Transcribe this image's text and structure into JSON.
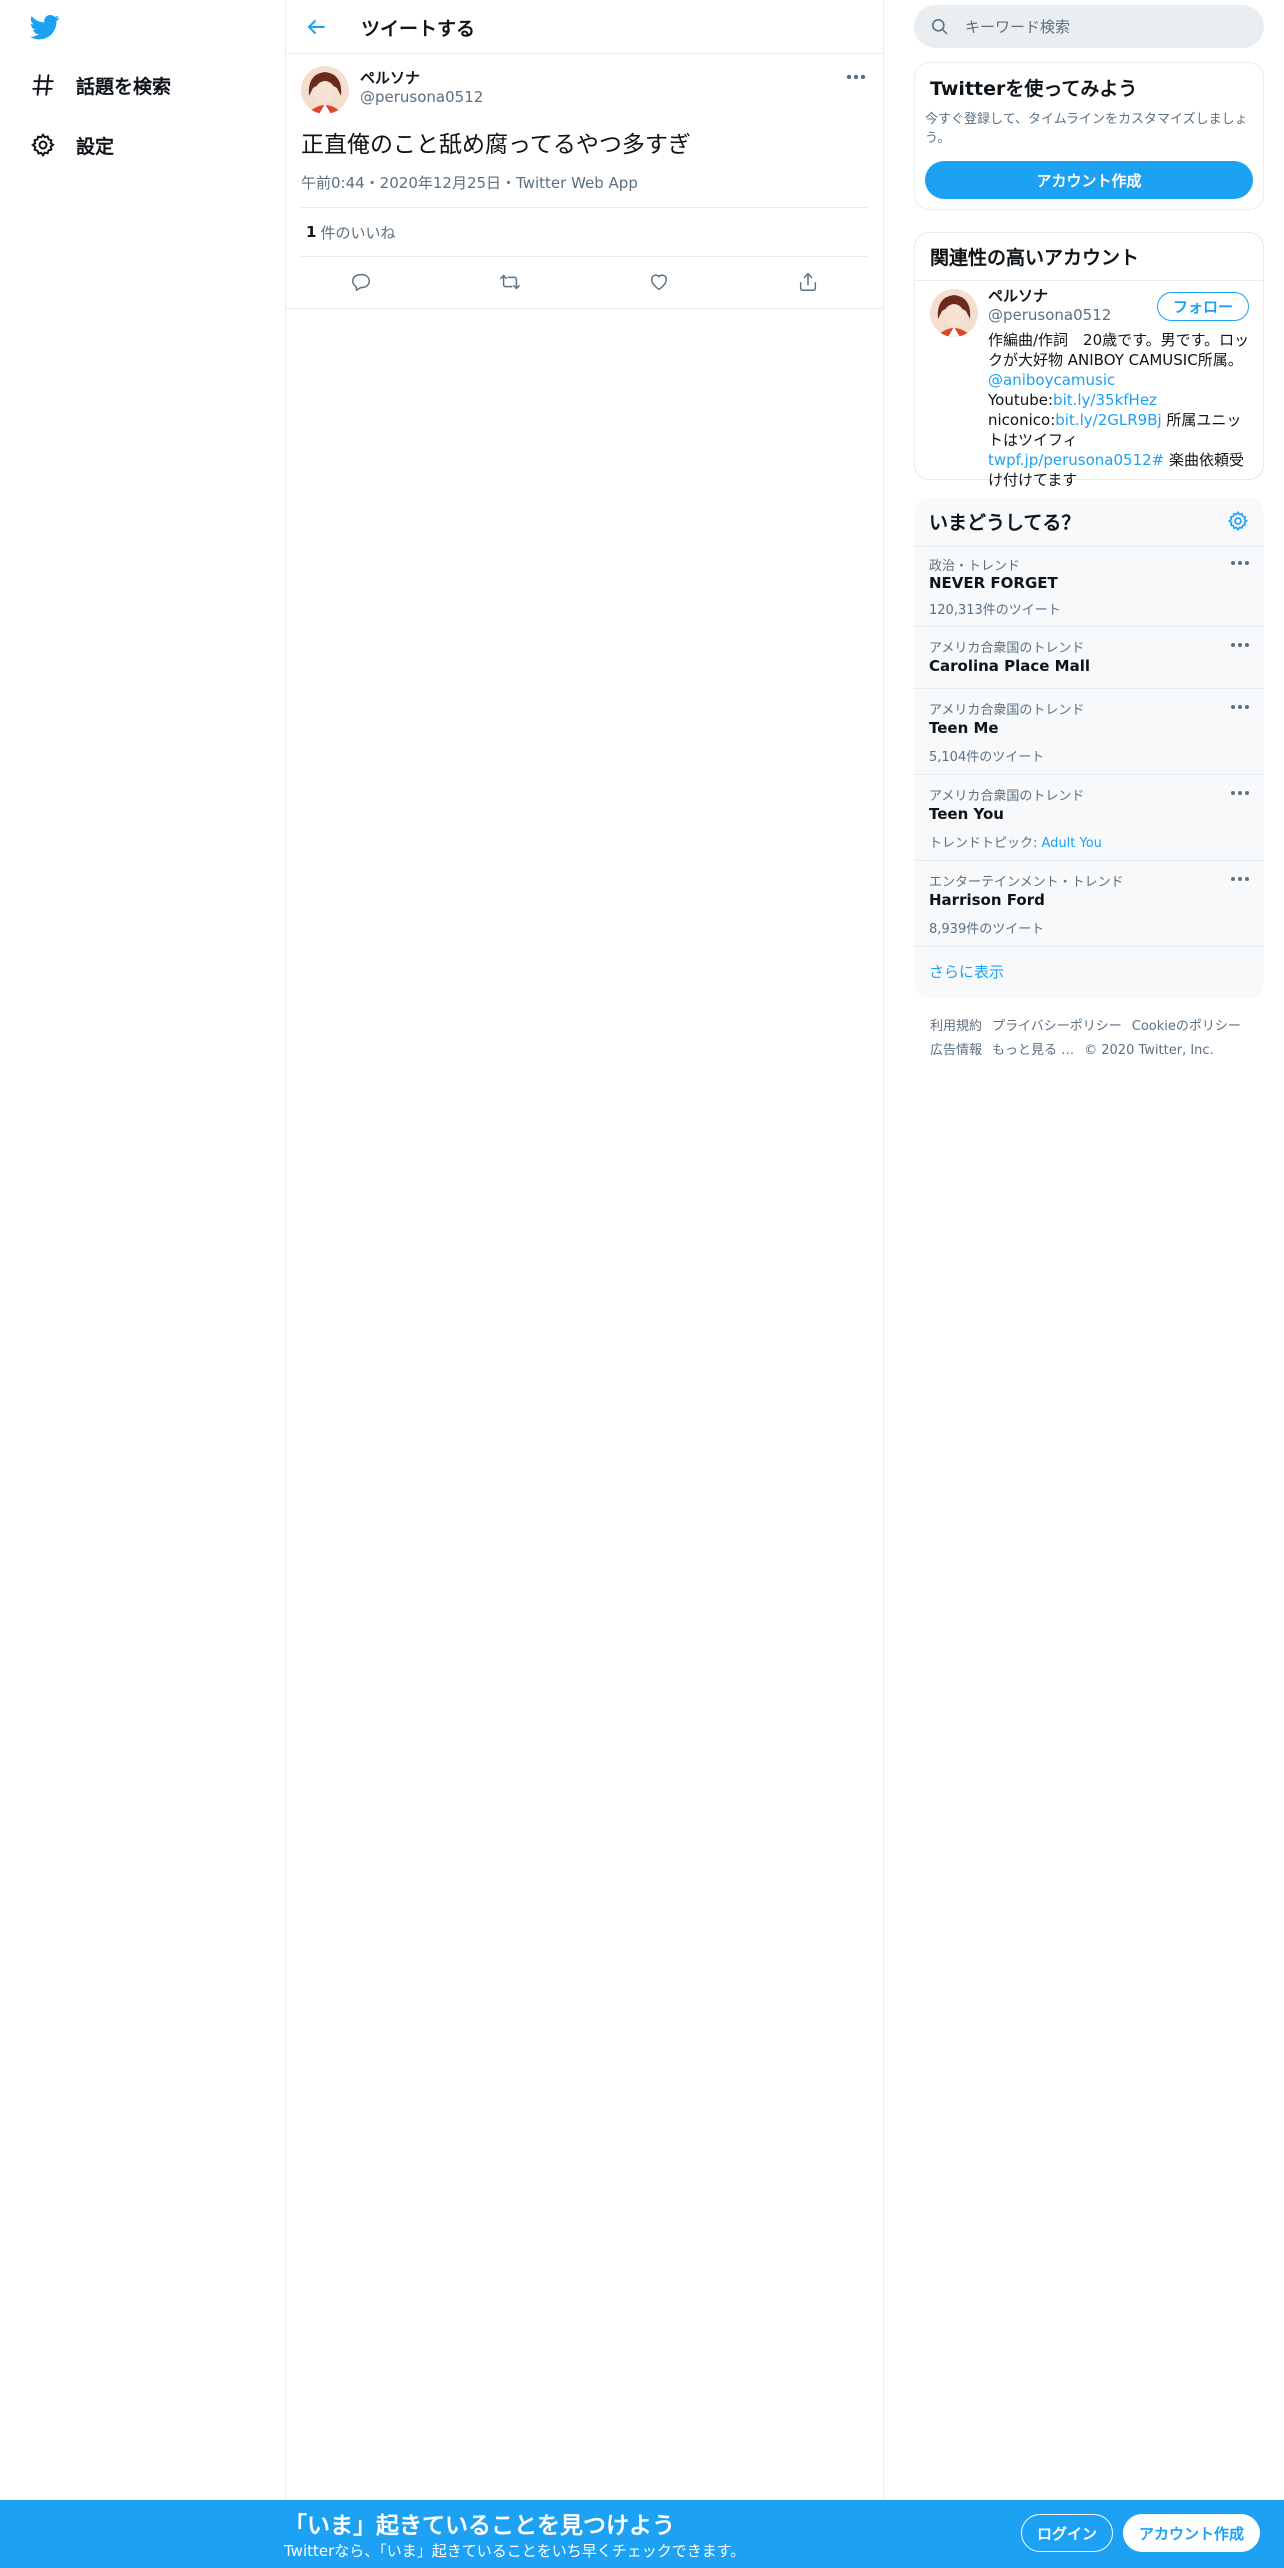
{
  "colors": {
    "accent": "#1da1f2",
    "text": "#0f1419",
    "muted": "#5b7083",
    "border": "#e6ecf0"
  },
  "nav": {
    "logo_icon": "twitter-bird-icon",
    "items": [
      {
        "label": "話題を検索",
        "icon": "hashtag-icon"
      },
      {
        "label": "設定",
        "icon": "gear-icon"
      }
    ]
  },
  "main": {
    "header_title": "ツイートする",
    "tweet": {
      "author_name": "ペルソナ",
      "author_handle": "@perusona0512",
      "text": "正直俺のこと舐め腐ってるやつ多すぎ",
      "meta": "午前0:44・2020年12月25日・Twitter Web App",
      "likes_count": "1",
      "likes_label": "件のいいね"
    }
  },
  "sidebar": {
    "search_placeholder": "キーワード検索",
    "signup": {
      "title": "Twitterを使ってみよう",
      "subtitle": "今すぐ登録して、タイムラインをカスタマイズしましょう。",
      "button": "アカウント作成"
    },
    "related": {
      "title": "関連性の高いアカウント",
      "name": "ペルソナ",
      "handle": "@perusona0512",
      "follow": "フォロー",
      "bio_1": "作編曲/作詞　20歳です。男です。ロックが大好物 ANIBOY CAMUSIC所属。",
      "bio_link1": "@aniboycamusic",
      "bio_2": "Youtube:",
      "bio_link2": "bit.ly/35kfHez",
      "bio_3": "niconico:",
      "bio_link3": "bit.ly/2GLR9Bj",
      "bio_4": " 所属ユニットはツイフィ ",
      "bio_link4": "twpf.jp/perusona0512#",
      "bio_5": " 楽曲依頼受け付けてます"
    },
    "trends": {
      "title": "いまどうしてる？",
      "items": [
        {
          "context": "政治・トレンド",
          "name": "NEVER FORGET",
          "count": "120,313件のツイート"
        },
        {
          "context": "アメリカ合衆国のトレンド",
          "name": "Carolina Place Mall",
          "count": ""
        },
        {
          "context": "アメリカ合衆国のトレンド",
          "name": "Teen Me",
          "count": "5,104件のツイート"
        },
        {
          "context": "アメリカ合衆国のトレンド",
          "name": "Teen You",
          "count_prefix": "トレンドトピック: ",
          "count_link": "Adult You"
        },
        {
          "context": "エンターテインメント・トレンド",
          "name": "Harrison Ford",
          "count": "8,939件のツイート"
        }
      ],
      "show_more": "さらに表示"
    },
    "footer": {
      "terms": "利用規約",
      "privacy": "プライバシーポリシー",
      "cookie": "Cookieのポリシー",
      "ads": "広告情報",
      "more": "もっと見る …",
      "copyright": "© 2020 Twitter, Inc."
    }
  },
  "bottom_bar": {
    "title": "「いま」起きていることを見つけよう",
    "subtitle": "Twitterなら、「いま」起きていることをいち早くチェックできます。",
    "login": "ログイン",
    "signup": "アカウント作成"
  }
}
